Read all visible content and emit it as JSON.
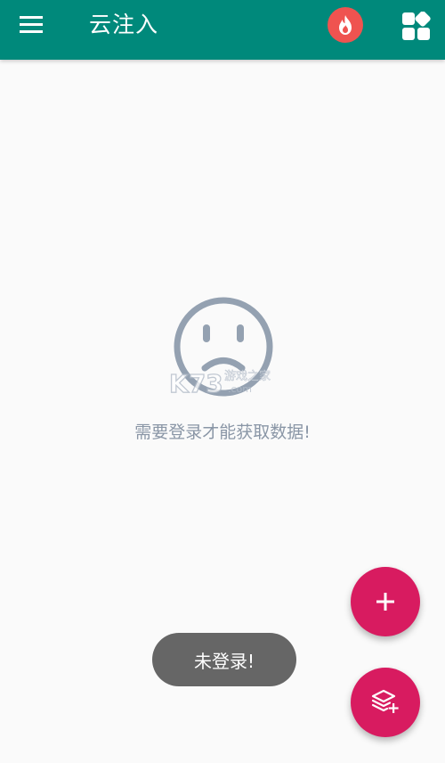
{
  "toolbar": {
    "title": "云注入",
    "background": "#00897b",
    "menu_icon": "hamburger-menu-icon",
    "hot_icon": "flame-icon",
    "apps_icon": "apps-grid-icon"
  },
  "empty_state": {
    "icon": "sad-face-icon",
    "message": "需要登录才能获取数据!"
  },
  "watermark": {
    "logo": "K73",
    "text": "游戏之家",
    "sub": ".com"
  },
  "toast": {
    "message": "未登录!"
  },
  "fab": {
    "add_icon": "plus-icon",
    "layers_icon": "layers-add-icon",
    "color": "#d81b60"
  }
}
